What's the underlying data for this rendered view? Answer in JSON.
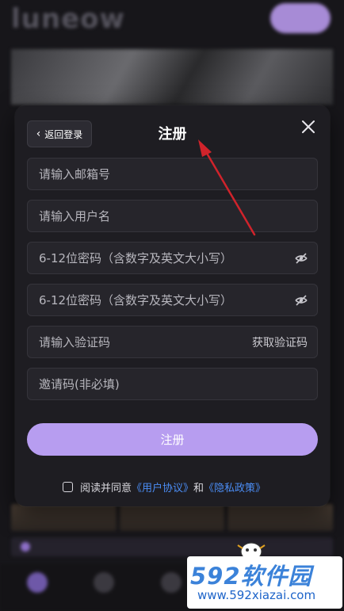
{
  "background": {
    "logo_text": "luneow"
  },
  "modal": {
    "back_label": "返回登录",
    "title": "注册",
    "fields": {
      "email_placeholder": "请输入邮箱号",
      "username_placeholder": "请输入用户名",
      "password_placeholder": "6-12位密码（含数字及英文大小写）",
      "confirm_password_placeholder": "6-12位密码（含数字及英文大小写）",
      "verification_placeholder": "请输入验证码",
      "get_code_label": "获取验证码",
      "invite_placeholder": "邀请码(非必填)"
    },
    "submit_label": "注册",
    "agreement": {
      "prefix": "阅读并同意",
      "user_agreement": "《用户协议》",
      "and": "和",
      "privacy_policy": "《隐私政策》"
    }
  },
  "watermark": {
    "logo": "592软件园",
    "url": "www.592xiazai.com"
  },
  "colors": {
    "accent": "#b79df0",
    "link": "#4b8df5",
    "modal_bg": "#1e1d22",
    "annotation_arrow": "#d0232b"
  },
  "icons": [
    "chevron-left-icon",
    "close-icon",
    "eye-off-icon",
    "eye-off-icon",
    "checkbox-icon"
  ]
}
